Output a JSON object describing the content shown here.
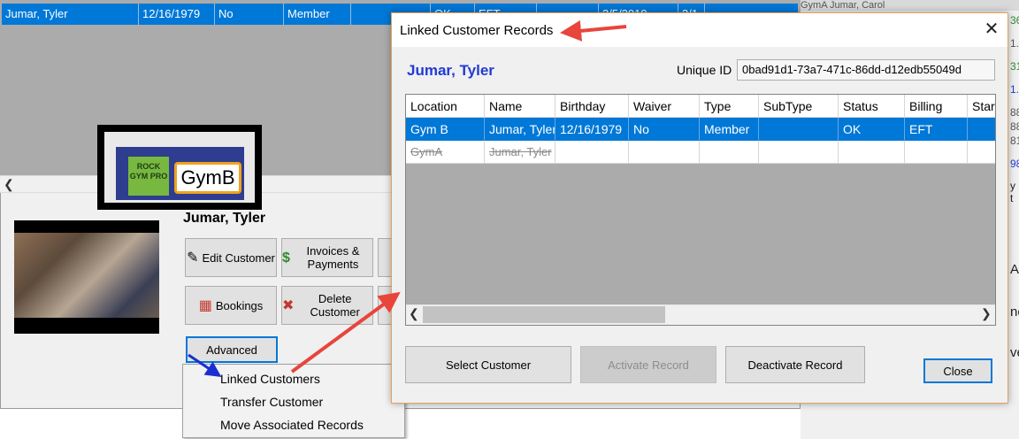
{
  "background": {
    "selected_row": [
      "Jumar, Tyler",
      "12/16/1979",
      "No",
      "Member",
      "",
      "OK",
      "EFT",
      "",
      "3/5/2019",
      "3/1"
    ],
    "customer_name": "Jumar, Tyler",
    "logo": {
      "badge": "ROCK GYM PRO",
      "gym": "GymB"
    },
    "buttons": {
      "edit": "Edit Customer",
      "invoices": "Invoices & Payments",
      "bookings": "Bookings",
      "delete": "Delete Customer",
      "advanced": "Advanced"
    },
    "advanced_menu": [
      "Linked Customers",
      "Transfer Customer",
      "Move Associated Records"
    ]
  },
  "right_strip": {
    "top_text": "GymA    Jumar, Carol",
    "numbers": [
      "36",
      "1.",
      "31",
      "1.",
      "88",
      "88",
      "81",
      "98"
    ],
    "frag1": "y t",
    "frag2": "A",
    "frag3": "ne",
    "frag4": "ve"
  },
  "dialog": {
    "title": "Linked Customer Records",
    "customer_name": "Jumar, Tyler",
    "unique_id_label": "Unique ID",
    "unique_id_value": "0bad91d1-73a7-471c-86dd-d12edb55049d",
    "columns": [
      "Location",
      "Name",
      "Birthday",
      "Waiver",
      "Type",
      "SubType",
      "Status",
      "Billing",
      "Start"
    ],
    "rows": [
      [
        "Gym B",
        "Jumar, Tyler",
        "12/16/1979",
        "No",
        "Member",
        "",
        "OK",
        "EFT",
        ""
      ],
      [
        "GymA",
        "Jumar, Tyler",
        "",
        "",
        "",
        "",
        "",
        "",
        ""
      ]
    ],
    "buttons": {
      "select": "Select Customer",
      "activate": "Activate Record",
      "deactivate": "Deactivate Record",
      "close": "Close"
    }
  },
  "colors": {
    "selection": "#0078d7",
    "dialog_name": "#1f3bd6",
    "arrow_red": "#e8453c",
    "arrow_blue": "#1a2fd0"
  }
}
